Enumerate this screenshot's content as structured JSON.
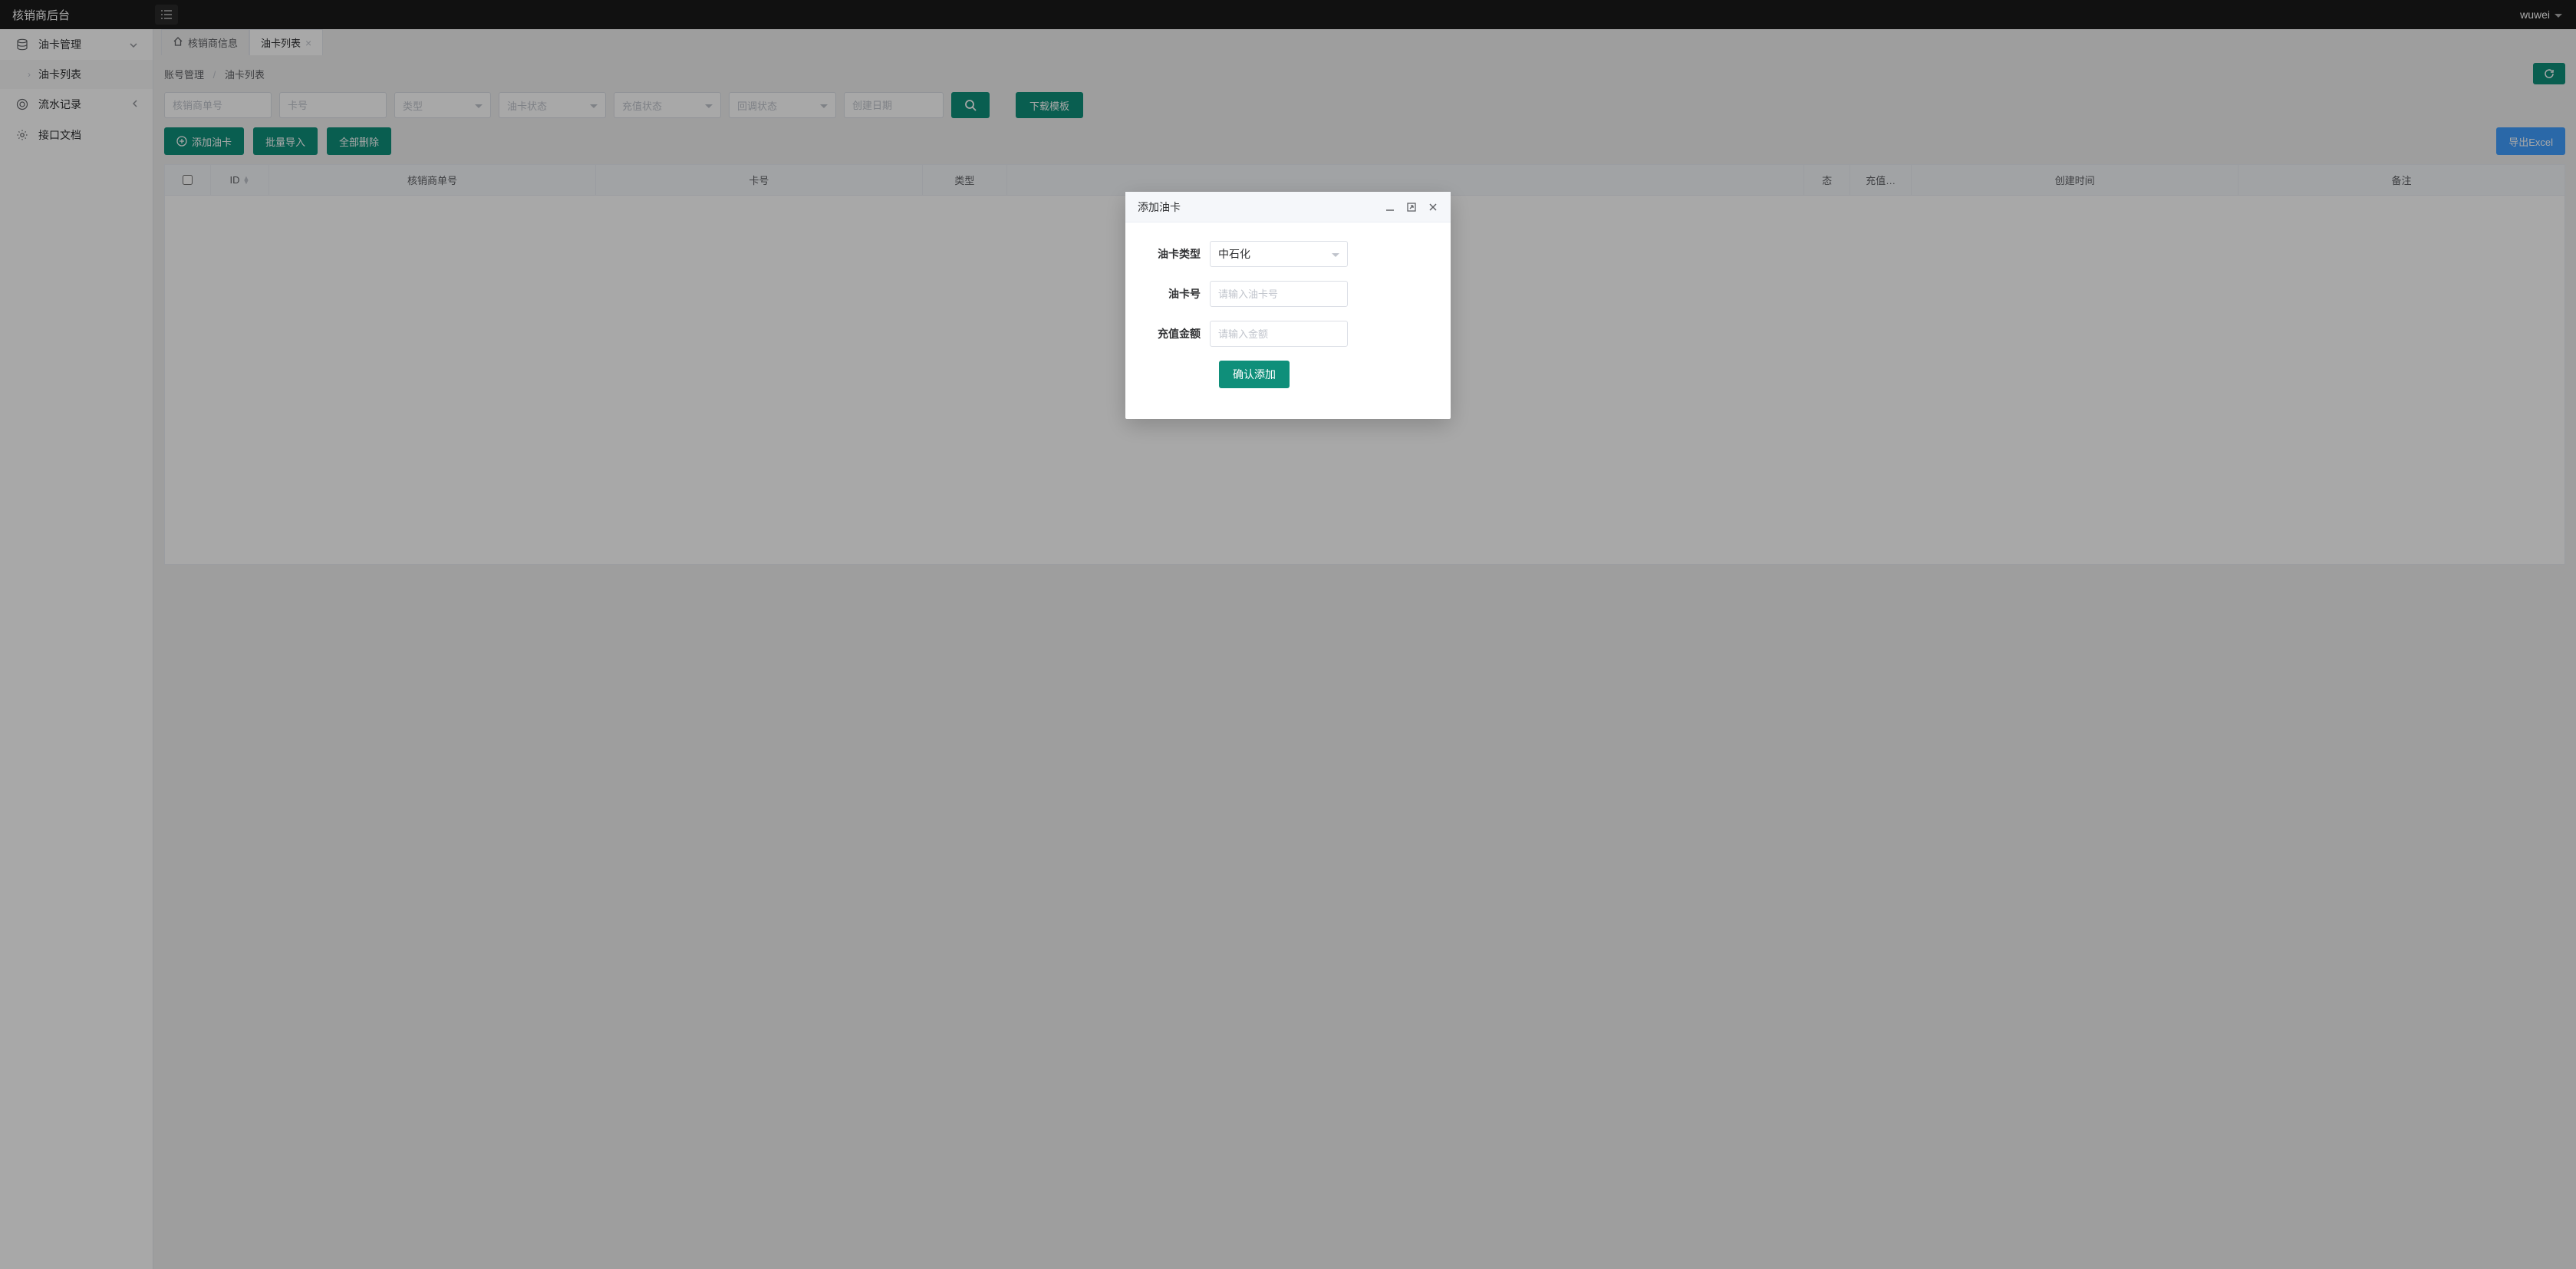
{
  "app": {
    "title": "核销商后台"
  },
  "user": {
    "name": "wuwei"
  },
  "sidebar": {
    "items": [
      {
        "label": "油卡管理",
        "expanded": true,
        "children": [
          {
            "label": "油卡列表"
          }
        ]
      },
      {
        "label": "流水记录"
      },
      {
        "label": "接口文档"
      }
    ]
  },
  "tabs": [
    {
      "label": "核销商信息",
      "home": true
    },
    {
      "label": "油卡列表",
      "active": true,
      "closable": true
    }
  ],
  "breadcrumb": {
    "root": "账号管理",
    "current": "油卡列表"
  },
  "filters": {
    "merchant_no_ph": "核销商单号",
    "card_no_ph": "卡号",
    "type_ph": "类型",
    "card_status_ph": "油卡状态",
    "recharge_status_ph": "充值状态",
    "callback_status_ph": "回调状态",
    "create_date_ph": "创建日期"
  },
  "buttons": {
    "download_template": "下载模板",
    "add_card": "添加油卡",
    "batch_import": "批量导入",
    "delete_all": "全部删除",
    "export_excel": "导出Excel"
  },
  "table": {
    "columns": [
      "ID",
      "核销商单号",
      "卡号",
      "类型",
      "",
      "态",
      "充值…",
      "创建时间",
      "备注"
    ]
  },
  "dialog": {
    "title": "添加油卡",
    "fields": {
      "type_label": "油卡类型",
      "type_value": "中石化",
      "card_no_label": "油卡号",
      "card_no_ph": "请输入油卡号",
      "amount_label": "充值金额",
      "amount_ph": "请输入金额"
    },
    "confirm": "确认添加"
  }
}
